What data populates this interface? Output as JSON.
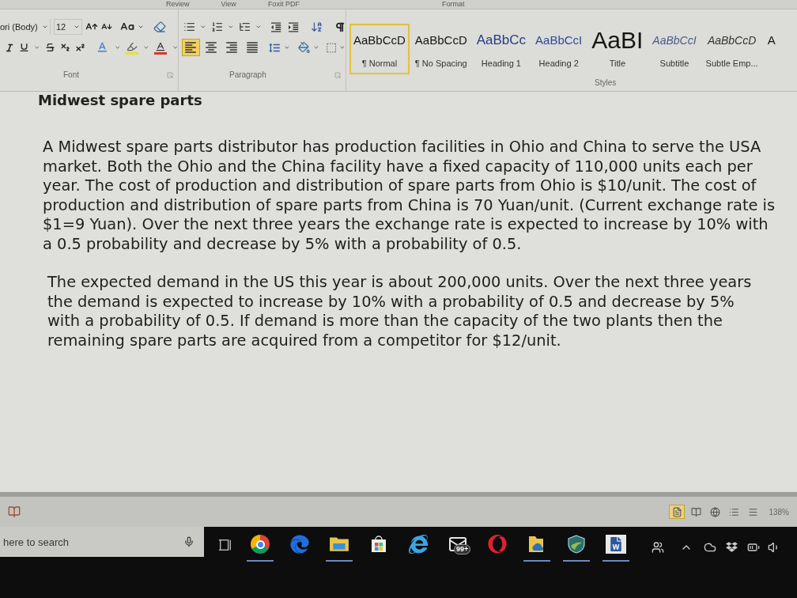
{
  "ribbon_tabs": [
    "Review",
    "View",
    "Foxit PDF",
    "Format"
  ],
  "font_group": {
    "font_name": "ori (Body)",
    "font_size": "12",
    "label": "Font"
  },
  "paragraph_group": {
    "label": "Paragraph",
    "alignment": [
      {
        "selected": true
      },
      {
        "selected": false
      },
      {
        "selected": false
      },
      {
        "selected": false
      }
    ]
  },
  "styles_group": {
    "label": "Styles",
    "items": [
      {
        "kind": "normal",
        "sample": "AaBbCcD",
        "label": "¶ Normal",
        "selected": true
      },
      {
        "kind": "normal",
        "sample": "AaBbCcD",
        "label": "¶ No Spacing",
        "selected": false
      },
      {
        "kind": "heading1",
        "sample": "AaBbCc",
        "label": "Heading 1",
        "selected": false
      },
      {
        "kind": "heading2",
        "sample": "AaBbCcI",
        "label": "Heading 2",
        "selected": false
      },
      {
        "kind": "title",
        "sample": "AaBI",
        "label": "Title",
        "selected": false
      },
      {
        "kind": "subtitle",
        "sample": "AaBbCcI",
        "label": "Subtitle",
        "selected": false
      },
      {
        "kind": "emphasis",
        "sample": "AaBbCcD",
        "label": "Subtle Emp...",
        "selected": false
      },
      {
        "kind": "normal",
        "sample": "A",
        "selected": false
      }
    ]
  },
  "document": {
    "heading": "Midwest spare parts",
    "paragraphs": [
      "A Midwest spare parts distributor has production facilities in Ohio and China to serve the USA market. Both the Ohio and the China facility have a fixed capacity of 110,000 units each per year. The cost of production and distribution of spare parts from Ohio is $10/unit. The cost of production and distribution of spare parts from China is 70 Yuan/unit. (Current exchange rate is $1=9 Yuan). Over the next three years the exchange rate is expected to increase by 10% with a 0.5 probability and decrease by 5% with a probability of 0.5.",
      "The expected demand in the US this year is about 200,000 units. Over the next three years the demand is expected to increase by 10% with a probability of 0.5 and decrease by 5% with a probability of 0.5. If demand is more than the capacity of the two plants then the remaining spare parts are acquired from a competitor for $12/unit."
    ]
  },
  "status_bar": {
    "views": [
      {
        "selected": true
      },
      {
        "selected": false
      },
      {
        "selected": false
      },
      {
        "selected": false
      },
      {
        "selected": false
      }
    ],
    "zoom": "138%"
  },
  "taskbar": {
    "search": {
      "placeholder": "here to search"
    },
    "apps": [
      {
        "running": true
      },
      {
        "running": false
      },
      {
        "running": true
      },
      {
        "running": false
      },
      {
        "running": false
      },
      {
        "running": false,
        "badge": "99+"
      },
      {
        "running": false
      },
      {
        "running": true
      },
      {
        "running": true
      },
      {
        "running": true
      }
    ]
  }
}
